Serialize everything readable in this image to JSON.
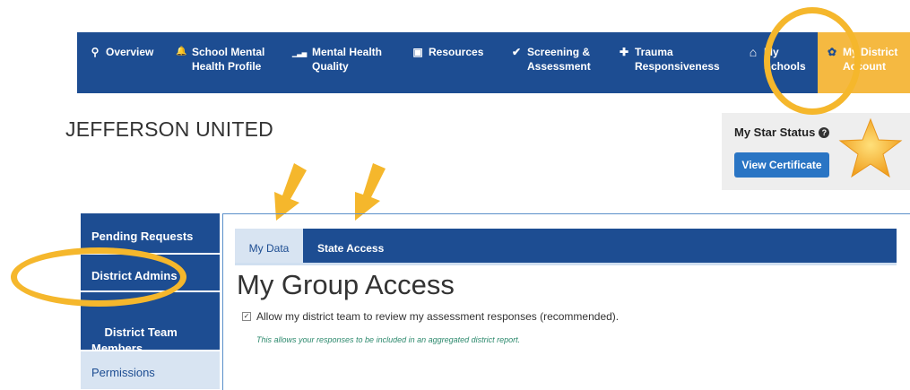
{
  "nav": {
    "items": [
      {
        "icon": "map-marker-icon",
        "glyph": "⚲",
        "label": "Overview"
      },
      {
        "icon": "bell-icon",
        "glyph": "🔔",
        "label": "School Mental\nHealth Profile"
      },
      {
        "icon": "bar-chart-icon",
        "glyph": "▁▃▅",
        "label": "Mental Health\nQuality"
      },
      {
        "icon": "image-icon",
        "glyph": "▣",
        "label": "Resources"
      },
      {
        "icon": "check-icon",
        "glyph": "✔",
        "label": "Screening &\nAssessment"
      },
      {
        "icon": "plus-icon",
        "glyph": "✚",
        "label": "Trauma\nResponsiveness"
      },
      {
        "icon": "home-icon",
        "glyph": "⌂",
        "label": "My\nSchools"
      },
      {
        "icon": "gear-icon",
        "glyph": "✿",
        "label": "My District\nAccount"
      }
    ]
  },
  "page": {
    "district_name": "JEFFERSON UNITED"
  },
  "star_status": {
    "label": "My Star Status",
    "help_glyph": "?",
    "button": "View Certificate"
  },
  "sidebar": {
    "items": [
      {
        "label": "Pending Requests"
      },
      {
        "label": "District Admins"
      },
      {
        "label": "District Team\nMembers"
      },
      {
        "label": "Permissions"
      }
    ]
  },
  "tabs": [
    {
      "label": "My Data"
    },
    {
      "label": "State Access"
    }
  ],
  "main": {
    "title": "My Group Access",
    "checkbox_label": "Allow my district team to review my assessment responses (recommended).",
    "checkbox_checked": true,
    "note": "This allows your responses to be included in an aggregated district report."
  },
  "colors": {
    "nav_bg": "#1d4d92",
    "active_nav": "#f5b941",
    "annotation": "#f5b72c",
    "button": "#2a75c4"
  }
}
